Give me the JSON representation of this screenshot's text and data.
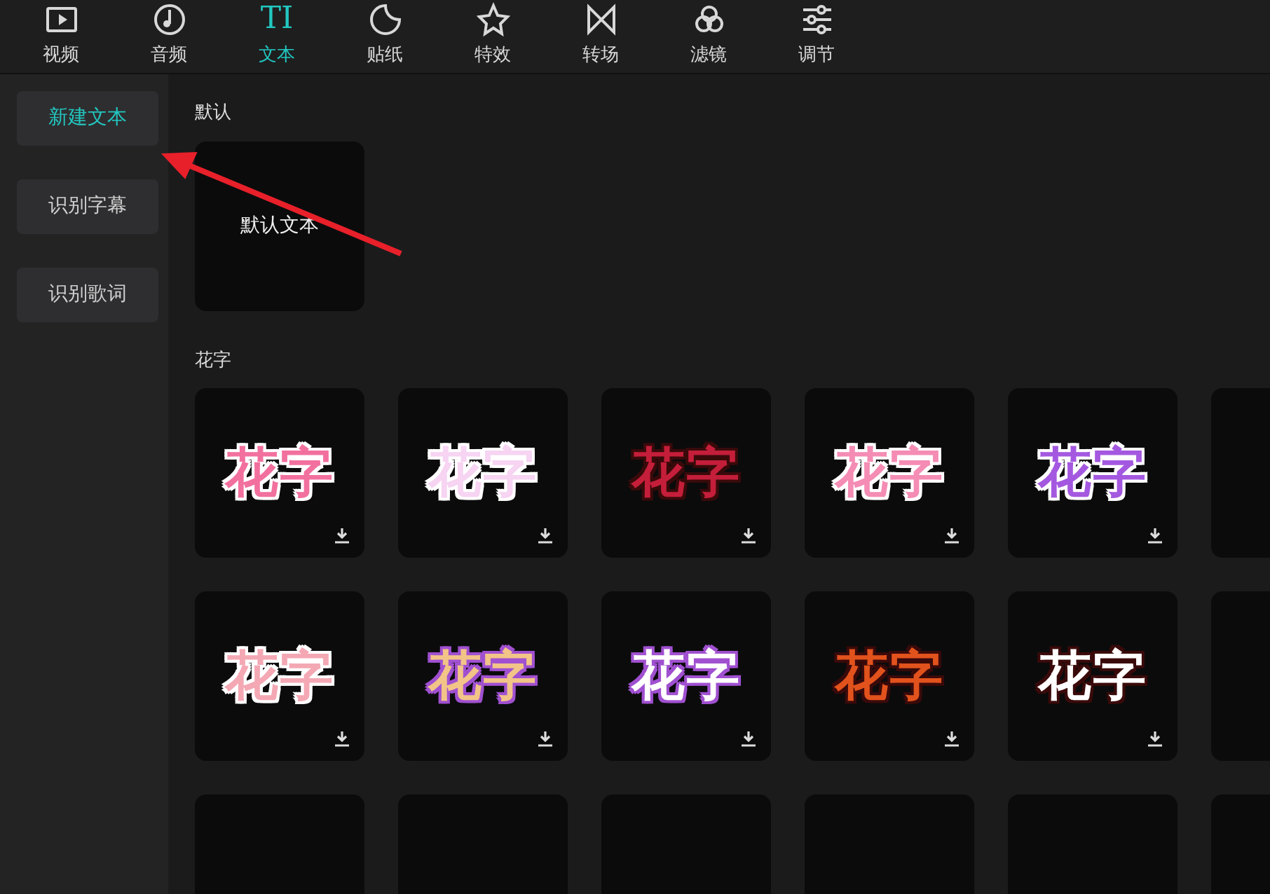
{
  "tabs": [
    {
      "kind": "video",
      "label": "视频",
      "selected": false
    },
    {
      "kind": "audio",
      "label": "音频",
      "selected": false
    },
    {
      "kind": "text",
      "icon_text": "TI",
      "label": "文本",
      "selected": true
    },
    {
      "kind": "sticker",
      "label": "贴纸",
      "selected": false
    },
    {
      "kind": "effect",
      "label": "特效",
      "selected": false
    },
    {
      "kind": "transition",
      "label": "转场",
      "selected": false
    },
    {
      "kind": "filter",
      "label": "滤镜",
      "selected": false
    },
    {
      "kind": "adjust",
      "label": "调节",
      "selected": false
    }
  ],
  "sidebar": {
    "items": [
      {
        "label": "新建文本",
        "selected": true
      },
      {
        "label": "识别字幕",
        "selected": false
      },
      {
        "label": "识别歌词",
        "selected": false
      }
    ]
  },
  "sections": [
    {
      "title": "默认",
      "tiles": [
        {
          "kind": "plain",
          "text": "默认文本"
        }
      ]
    },
    {
      "title": "花字",
      "tiles": [
        {
          "kind": "outlined",
          "text": "花字",
          "color": "#f2709e"
        },
        {
          "kind": "outlined",
          "text": "花字",
          "color": "#f6d4f2"
        },
        {
          "kind": "shadowed",
          "text": "花字",
          "color": "#c41e3a"
        },
        {
          "kind": "outlined",
          "text": "花字",
          "color": "#f48cb4"
        },
        {
          "kind": "outlined",
          "text": "花字",
          "color": "#a458e0"
        },
        {
          "kind": "cut"
        },
        {
          "kind": "outlined",
          "text": "花字",
          "color": "#f4a8b4"
        },
        {
          "kind": "glowing",
          "text": "花字",
          "color": "#f2c488"
        },
        {
          "kind": "glowing",
          "text": "花字",
          "color": "#ffffff"
        },
        {
          "kind": "shadowed",
          "text": "花字",
          "color": "#e2521c"
        },
        {
          "kind": "shadowed",
          "text": "花字",
          "color": "#ffffff"
        },
        {
          "kind": "cut"
        },
        {
          "kind": "cut"
        },
        {
          "kind": "cut"
        },
        {
          "kind": "cut"
        },
        {
          "kind": "cut"
        },
        {
          "kind": "cut"
        },
        {
          "kind": "cut"
        }
      ]
    }
  ]
}
